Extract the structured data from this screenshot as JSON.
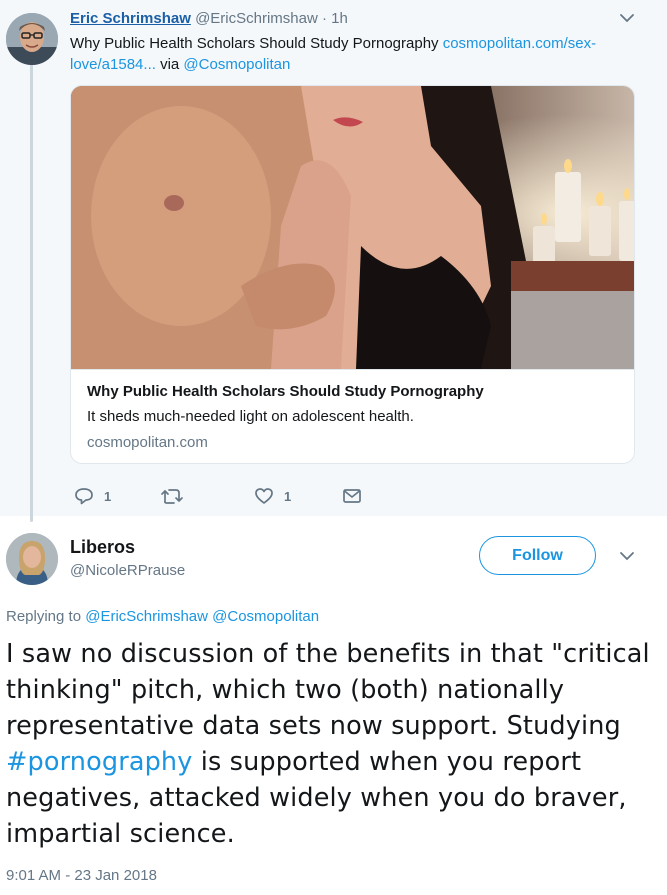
{
  "parent_tweet": {
    "display_name": "Eric Schrimshaw",
    "handle": "@EricSchrimshaw",
    "separator": "·",
    "time": "1h",
    "text_plain": "Why Public Health Scholars Should Study Pornography ",
    "text_link": "cosmopolitan.com/sex-love/a1584...",
    "text_via": " via ",
    "text_mention": "@Cosmopolitan",
    "card": {
      "title": "Why Public Health Scholars Should Study Pornography",
      "description": "It sheds much-needed light on adolescent health.",
      "domain": "cosmopolitan.com"
    },
    "actions": {
      "reply_count": "1",
      "retweet_count": "",
      "like_count": "1"
    }
  },
  "main_tweet": {
    "display_name": "Liberos",
    "handle": "@NicoleRPrause",
    "follow_label": "Follow",
    "replying_label": "Replying to ",
    "replying_user1": "@EricSchrimshaw",
    "replying_user2": "@Cosmopolitan",
    "text_before": "I saw no discussion of the benefits in that \"critical thinking\" pitch, which two (both) nationally representative data sets now support. Studying ",
    "hashtag": "#pornography",
    "text_after": " is supported when you report negatives, attacked widely when you do braver, impartial science.",
    "timestamp": "9:01 AM - 23 Jan 2018"
  },
  "colors": {
    "link": "#1b95e0",
    "name_link": "#1b5fa6",
    "muted": "#657786",
    "parent_bg": "#f5f8fa"
  },
  "icons": [
    "chevron-down-icon",
    "reply-icon",
    "retweet-icon",
    "heart-icon",
    "dm-envelope-icon"
  ]
}
